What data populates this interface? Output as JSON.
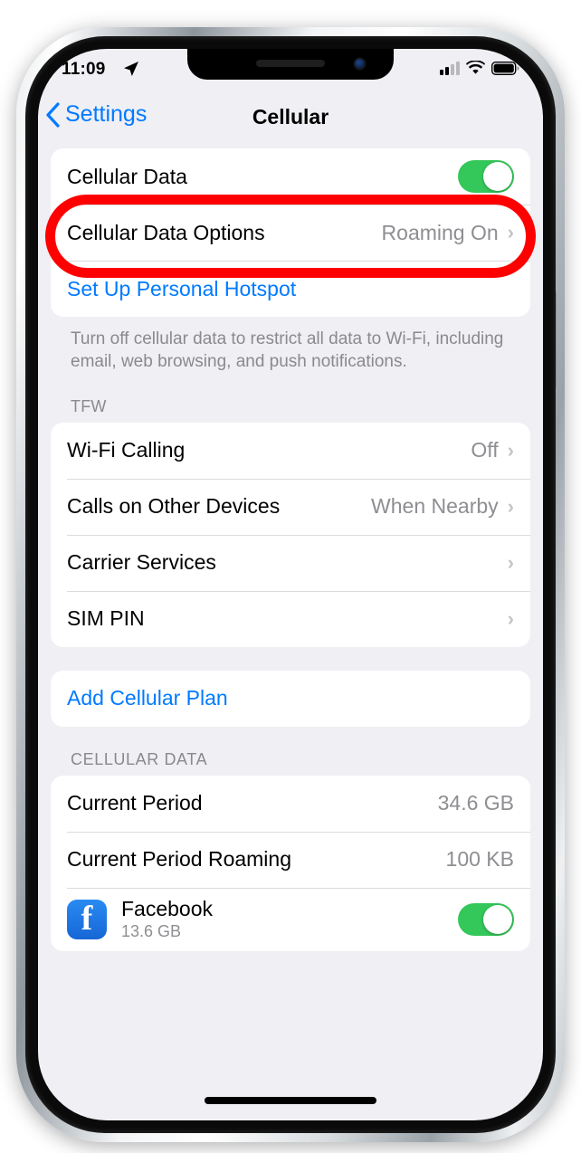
{
  "status_bar": {
    "time": "11:09",
    "location_icon": "location-arrow-icon",
    "signal_icon": "cellular-signal-icon",
    "signal_bars_filled": 2,
    "signal_bars_total": 4,
    "wifi_icon": "wifi-icon",
    "battery_icon": "battery-full-icon"
  },
  "nav": {
    "back_label": "Settings",
    "back_icon": "chevron-left-icon",
    "title": "Cellular"
  },
  "sections": {
    "data": {
      "rows": [
        {
          "label": "Cellular Data",
          "control": "toggle",
          "toggle_on": true,
          "highlighted": true
        },
        {
          "label": "Cellular Data Options",
          "value": "Roaming On",
          "control": "chevron"
        },
        {
          "label": "Set Up Personal Hotspot",
          "style": "blue",
          "control": "none"
        }
      ],
      "footer": "Turn off cellular data to restrict all data to Wi-Fi, including email, web browsing, and push notifications."
    },
    "carrier": {
      "header": "TFW",
      "rows": [
        {
          "label": "Wi-Fi Calling",
          "value": "Off",
          "control": "chevron"
        },
        {
          "label": "Calls on Other Devices",
          "value": "When Nearby",
          "control": "chevron"
        },
        {
          "label": "Carrier Services",
          "value": "",
          "control": "chevron"
        },
        {
          "label": "SIM PIN",
          "value": "",
          "control": "chevron"
        }
      ]
    },
    "plan": {
      "rows": [
        {
          "label": "Add Cellular Plan",
          "style": "blue",
          "control": "none"
        }
      ]
    },
    "cellular_data_usage": {
      "header": "CELLULAR DATA",
      "rows": [
        {
          "label": "Current Period",
          "value": "34.6 GB",
          "control": "none"
        },
        {
          "label": "Current Period Roaming",
          "value": "100 KB",
          "control": "none"
        }
      ],
      "apps": [
        {
          "name": "Facebook",
          "size": "13.6 GB",
          "icon": "facebook-icon",
          "toggle_on": true
        }
      ]
    }
  },
  "annotation": {
    "shape": "oval-highlight",
    "color": "#fe0000",
    "targets": "Cellular Data"
  },
  "chevron_glyph": "›"
}
